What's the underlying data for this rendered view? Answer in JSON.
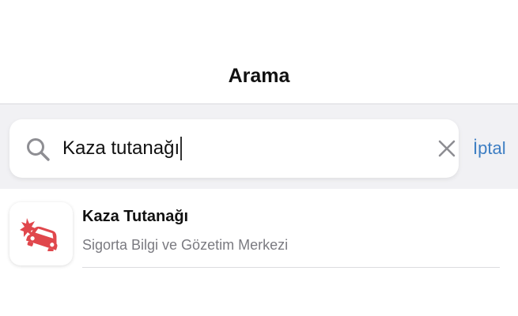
{
  "nav": {
    "title": "Arama"
  },
  "search": {
    "value": "Kaza tutanağı",
    "icon": "search-icon",
    "clear_icon": "close-icon"
  },
  "cancel": {
    "label": "İptal",
    "color": "#3d7ec3"
  },
  "results": [
    {
      "title": "Kaza Tutanağı",
      "subtitle": "Sigorta Bilgi ve Gözetim Merkezi",
      "icon": "car-crash-icon",
      "icon_color": "#e0474c"
    }
  ],
  "colors": {
    "search_area_bg": "#f1f1f4",
    "text_primary": "#111111",
    "text_secondary": "#7a7a80"
  }
}
